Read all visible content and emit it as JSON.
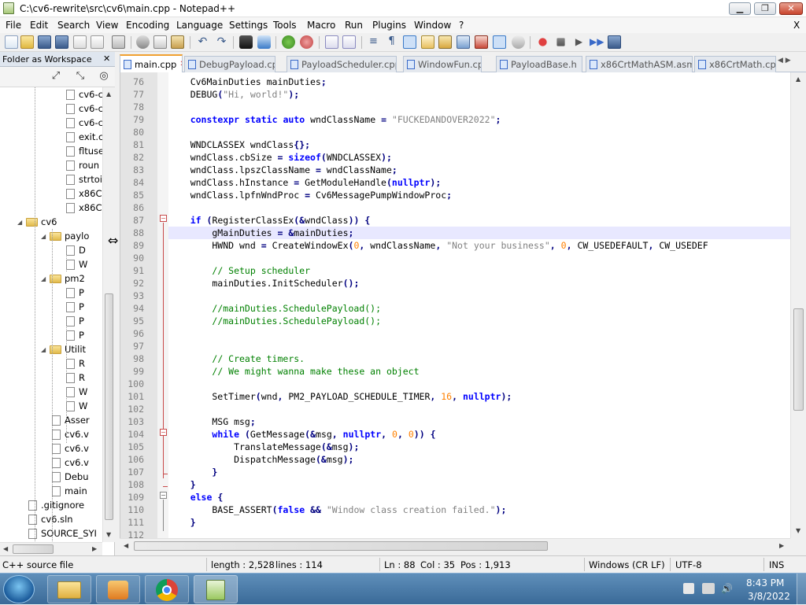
{
  "window": {
    "title": "C:\\cv6-rewrite\\src\\cv6\\main.cpp - Notepad++",
    "minimize": "▁",
    "restore": "❐",
    "close": "✕"
  },
  "menu": {
    "items": [
      "File",
      "Edit",
      "Search",
      "View",
      "Encoding",
      "Language",
      "Settings",
      "Tools",
      "Macro",
      "Run",
      "Plugins",
      "Window",
      "?"
    ],
    "close_doc": "X"
  },
  "panel": {
    "title": "Folder as Workspace",
    "close": "✕",
    "tree": [
      {
        "label": "cv6-c",
        "type": "file",
        "depth": 3
      },
      {
        "label": "cv6-c",
        "type": "file",
        "depth": 3
      },
      {
        "label": "cv6-c",
        "type": "file",
        "depth": 3
      },
      {
        "label": "exit.c",
        "type": "file",
        "depth": 3
      },
      {
        "label": "fltuse",
        "type": "file",
        "depth": 3
      },
      {
        "label": "roun",
        "type": "file",
        "depth": 3
      },
      {
        "label": "strtoi",
        "type": "file",
        "depth": 3
      },
      {
        "label": "x86C",
        "type": "file",
        "depth": 3
      },
      {
        "label": "x86C",
        "type": "file",
        "depth": 3
      },
      {
        "label": "cv6",
        "type": "folder",
        "depth": 1,
        "expanded": true
      },
      {
        "label": "paylo",
        "type": "folder",
        "depth": 2,
        "expanded": true
      },
      {
        "label": "D",
        "type": "file",
        "depth": 3
      },
      {
        "label": "W",
        "type": "file",
        "depth": 3
      },
      {
        "label": "pm2",
        "type": "folder",
        "depth": 2,
        "expanded": true
      },
      {
        "label": "P",
        "type": "file",
        "depth": 3
      },
      {
        "label": "P",
        "type": "file",
        "depth": 3
      },
      {
        "label": "P",
        "type": "file",
        "depth": 3
      },
      {
        "label": "P",
        "type": "file",
        "depth": 3
      },
      {
        "label": "Utilit",
        "type": "folder",
        "depth": 2,
        "expanded": true
      },
      {
        "label": "R",
        "type": "file",
        "depth": 3
      },
      {
        "label": "R",
        "type": "file",
        "depth": 3
      },
      {
        "label": "W",
        "type": "file",
        "depth": 3
      },
      {
        "label": "W",
        "type": "file",
        "depth": 3
      },
      {
        "label": "Asser",
        "type": "file",
        "depth": 2
      },
      {
        "label": "cv6.v",
        "type": "file",
        "depth": 2
      },
      {
        "label": "cv6.v",
        "type": "file",
        "depth": 2
      },
      {
        "label": "cv6.v",
        "type": "file",
        "depth": 2
      },
      {
        "label": "Debu",
        "type": "file",
        "depth": 2
      },
      {
        "label": "main",
        "type": "file",
        "depth": 2
      },
      {
        "label": ".gitignore",
        "type": "file",
        "depth": 1
      },
      {
        "label": "cv6.sln",
        "type": "file",
        "depth": 1
      },
      {
        "label": "SOURCE_SYI",
        "type": "file",
        "depth": 1
      }
    ]
  },
  "tabs": [
    {
      "label": "main.cpp",
      "active": true
    },
    {
      "label": "DebugPayload.cpp",
      "active": false
    },
    {
      "label": "PayloadScheduler.cpp",
      "active": false
    },
    {
      "label": "WindowFun.cpp",
      "active": false
    },
    {
      "label": "PayloadBase.h",
      "active": false
    },
    {
      "label": "x86CrtMathASM.asm",
      "active": false
    },
    {
      "label": "x86CrtMath.cpp",
      "active": false
    }
  ],
  "editor": {
    "current_line": 88,
    "lines": [
      {
        "n": "76",
        "code": "    Cv6MainDuties mainDuties;"
      },
      {
        "n": "77",
        "code": "    DEBUG(\"Hi, world!\");"
      },
      {
        "n": "78",
        "code": ""
      },
      {
        "n": "79",
        "code": "    constexpr static auto wndClassName = \"FUCKEDANDOVER2022\";"
      },
      {
        "n": "80",
        "code": ""
      },
      {
        "n": "81",
        "code": "    WNDCLASSEX wndClass{};"
      },
      {
        "n": "82",
        "code": "    wndClass.cbSize = sizeof(WNDCLASSEX);"
      },
      {
        "n": "83",
        "code": "    wndClass.lpszClassName = wndClassName;"
      },
      {
        "n": "84",
        "code": "    wndClass.hInstance = GetModuleHandle(nullptr);"
      },
      {
        "n": "85",
        "code": "    wndClass.lpfnWndProc = Cv6MessagePumpWindowProc;"
      },
      {
        "n": "86",
        "code": ""
      },
      {
        "n": "87",
        "code": "    if (RegisterClassEx(&wndClass)) {"
      },
      {
        "n": "88",
        "code": "        gMainDuties = &mainDuties;"
      },
      {
        "n": "89",
        "code": "        HWND wnd = CreateWindowEx(0, wndClassName, \"Not your business\", 0, CW_USEDEFAULT, CW_USEDEF"
      },
      {
        "n": "90",
        "code": ""
      },
      {
        "n": "91",
        "code": "        // Setup scheduler"
      },
      {
        "n": "92",
        "code": "        mainDuties.InitScheduler();"
      },
      {
        "n": "93",
        "code": ""
      },
      {
        "n": "94",
        "code": "        //mainDuties.SchedulePayload();"
      },
      {
        "n": "95",
        "code": "        //mainDuties.SchedulePayload();"
      },
      {
        "n": "96",
        "code": ""
      },
      {
        "n": "97",
        "code": ""
      },
      {
        "n": "98",
        "code": "        // Create timers."
      },
      {
        "n": "99",
        "code": "        // We might wanna make these an object"
      },
      {
        "n": "100",
        "code": ""
      },
      {
        "n": "101",
        "code": "        SetTimer(wnd, PM2_PAYLOAD_SCHEDULE_TIMER, 16, nullptr);"
      },
      {
        "n": "102",
        "code": ""
      },
      {
        "n": "103",
        "code": "        MSG msg;"
      },
      {
        "n": "104",
        "code": "        while (GetMessage(&msg, nullptr, 0, 0)) {"
      },
      {
        "n": "105",
        "code": "            TranslateMessage(&msg);"
      },
      {
        "n": "106",
        "code": "            DispatchMessage(&msg);"
      },
      {
        "n": "107",
        "code": "        }"
      },
      {
        "n": "108",
        "code": "    }"
      },
      {
        "n": "109",
        "code": "    else {"
      },
      {
        "n": "110",
        "code": "        BASE_ASSERT(false && \"Window class creation failed.\");"
      },
      {
        "n": "111",
        "code": "    }"
      },
      {
        "n": "112",
        "code": ""
      }
    ]
  },
  "status": {
    "file_type": "C++ source file",
    "length": "length : 2,528",
    "lines": "lines : 114",
    "ln": "Ln : 88",
    "col": "Col : 35",
    "pos": "Pos : 1,913",
    "eol": "Windows (CR LF)",
    "encoding": "UTF-8",
    "mode": "INS"
  },
  "taskbar": {
    "time": "8:43 PM",
    "date": "3/8/2022",
    "apps": [
      "explorer-icon",
      "media-player-icon",
      "chrome-icon",
      "notepad-plus-plus-icon"
    ]
  },
  "colors": {
    "keyword": "#0000ff",
    "type_keyword": "#8000ff",
    "string": "#808080",
    "number": "#ff8000",
    "comment": "#008000",
    "current_line_bg": "#e8e8ff",
    "taskbar": "#4a7aa8"
  }
}
